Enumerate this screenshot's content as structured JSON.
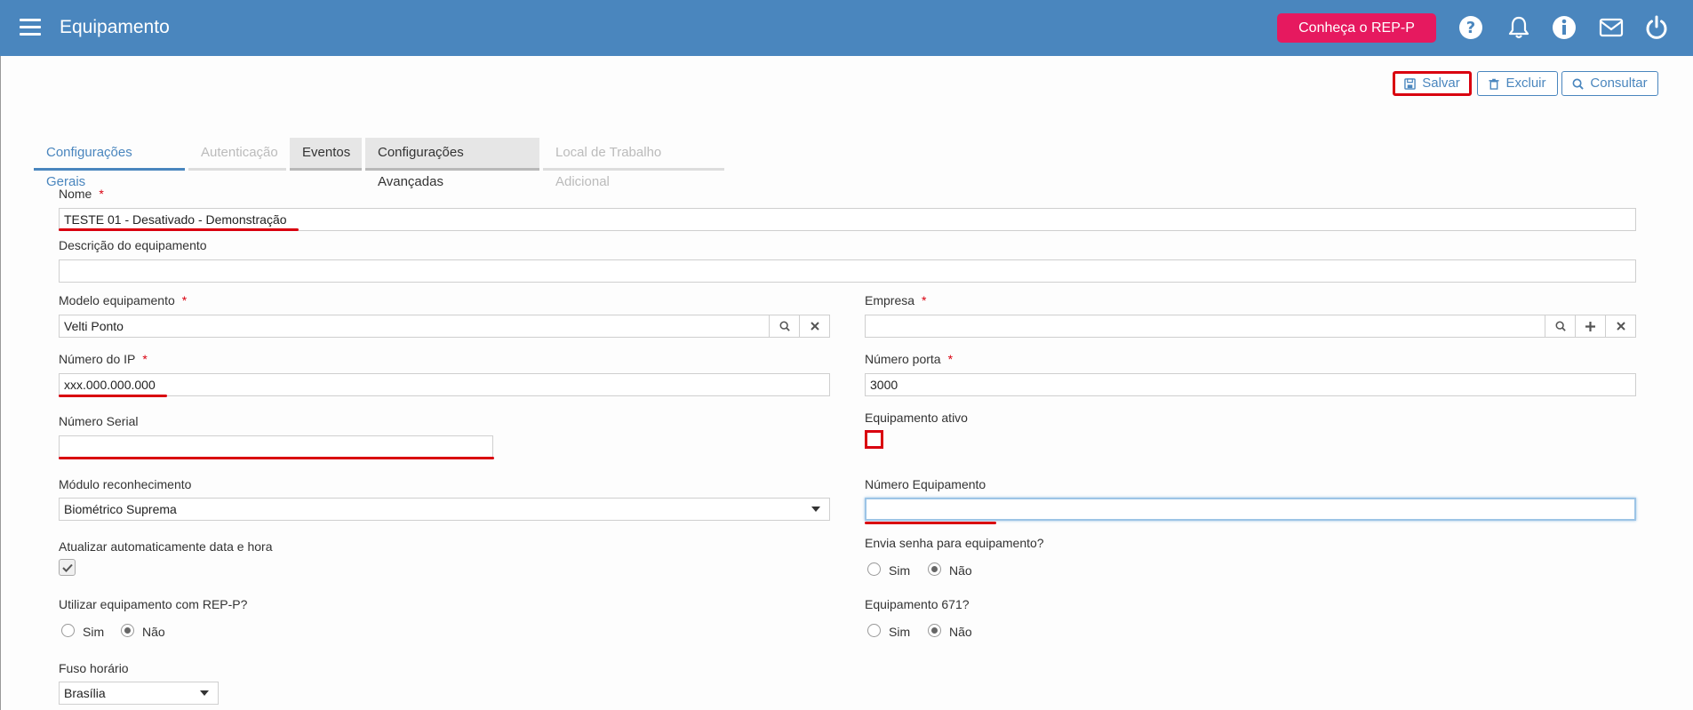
{
  "header": {
    "title": "Equipamento",
    "rep_button": "Conheça o REP-P",
    "icons": [
      "menu-icon",
      "help-icon",
      "bell-icon",
      "info-icon",
      "mail-icon",
      "power-icon"
    ]
  },
  "toolbar": {
    "save_label": "Salvar",
    "delete_label": "Excluir",
    "query_label": "Consultar"
  },
  "tabs": [
    {
      "label": "Configurações Gerais",
      "state": "active"
    },
    {
      "label": "Autenticação",
      "state": "disabled"
    },
    {
      "label": "Eventos",
      "state": "normal"
    },
    {
      "label": "Configurações Avançadas",
      "state": "normal"
    },
    {
      "label": "Local de Trabalho Adicional",
      "state": "disabled"
    }
  ],
  "form": {
    "nome": {
      "label": "Nome",
      "value": "TESTE 01 - Desativado - Demonstração"
    },
    "descricao": {
      "label": "Descrição do equipamento",
      "value": ""
    },
    "modelo": {
      "label": "Modelo equipamento",
      "value": "Velti Ponto"
    },
    "empresa": {
      "label": "Empresa",
      "value": ""
    },
    "ip": {
      "label": "Número do IP",
      "value": "xxx.000.000.000"
    },
    "porta": {
      "label": "Número porta",
      "value": "3000"
    },
    "serial": {
      "label": "Número Serial",
      "value": ""
    },
    "ativo": {
      "label": "Equipamento ativo",
      "checked": false
    },
    "modulo": {
      "label": "Módulo reconhecimento",
      "value": "Biométrico Suprema"
    },
    "num_equip": {
      "label": "Número Equipamento",
      "value": ""
    },
    "atualizar": {
      "label": "Atualizar automaticamente data e hora",
      "checked": true
    },
    "envia_senha": {
      "label": "Envia senha para equipamento?",
      "options": [
        "Sim",
        "Não"
      ],
      "selected": "Não"
    },
    "rep_p": {
      "label": "Utilizar equipamento com REP-P?",
      "options": [
        "Sim",
        "Não"
      ],
      "selected": "Não"
    },
    "e671": {
      "label": "Equipamento 671?",
      "options": [
        "Sim",
        "Não"
      ],
      "selected": "Não"
    },
    "fuso": {
      "label": "Fuso horário",
      "value": "Brasília"
    }
  },
  "required_mark": "*",
  "colors": {
    "header": "#4a86be",
    "accent": "#e6195f",
    "highlight": "#d9000f"
  }
}
